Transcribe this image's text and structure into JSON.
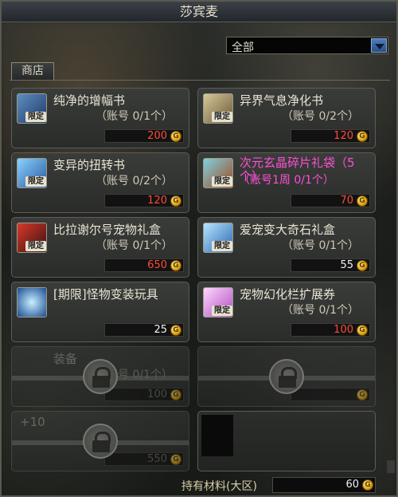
{
  "window": {
    "title": "莎宾麦"
  },
  "filter": {
    "selected": "全部"
  },
  "tabs": {
    "shop": "商店"
  },
  "badge_text": "限定",
  "items": [
    {
      "name": "纯净的增幅书",
      "limit": "（账号 0/1个）",
      "price": "200",
      "price_color": "#ff4a3a",
      "name_color": "#e9e5d4",
      "icon": "hat-icon"
    },
    {
      "name": "异界气息净化书",
      "limit": "（账号 0/2个）",
      "price": "120",
      "price_color": "#ff4a3a",
      "name_color": "#e9e5d4",
      "icon": "scroll-icon"
    },
    {
      "name": "变异的扭转书",
      "limit": "（账号 0/2个）",
      "price": "120",
      "price_color": "#ff4a3a",
      "name_color": "#e9e5d4",
      "icon": "blue-ball-icon"
    },
    {
      "name": "次元玄晶碎片礼袋（5个）",
      "limit": "（账号1周 0/1个）",
      "price": "70",
      "price_color": "#ff4a3a",
      "name_color": "#ff4fd6",
      "icon": "bag-icon"
    },
    {
      "name": "比拉谢尔号宠物礼盒",
      "limit": "（账号 0/1个）",
      "price": "650",
      "price_color": "#ff4a3a",
      "name_color": "#e9e5d4",
      "icon": "pet-box-icon"
    },
    {
      "name": "爱宠变大奇石礼盒",
      "limit": "（账号 0/1个）",
      "price": "55",
      "price_color": "#f2f2f2",
      "name_color": "#e9e5d4",
      "icon": "gift-box-icon"
    },
    {
      "name": "[期限]怪物变装玩具",
      "limit": "",
      "price": "25",
      "price_color": "#f2f2f2",
      "name_color": "#e9e5d4",
      "icon": "monster-toy-icon"
    },
    {
      "name": "宠物幻化栏扩展券",
      "limit": "（账号 0/1个）",
      "price": "100",
      "price_color": "#ff4a3a",
      "name_color": "#e9e5d4",
      "icon": "ticket-icon"
    }
  ],
  "locked_items": [
    {
      "name": "装备",
      "limit": "（账号 0/1个）",
      "price": "100"
    },
    {
      "name": "",
      "limit": "",
      "price": ""
    },
    {
      "name": "+10",
      "limit": "",
      "price": "550"
    },
    {
      "name": "",
      "limit": "",
      "price": ""
    }
  ],
  "footer": {
    "label": "持有材料(大区)",
    "value": "60"
  },
  "colors": {
    "price_red": "#ff4a3a",
    "rare_pink": "#ff4fd6",
    "gold": "#e2a00a"
  }
}
